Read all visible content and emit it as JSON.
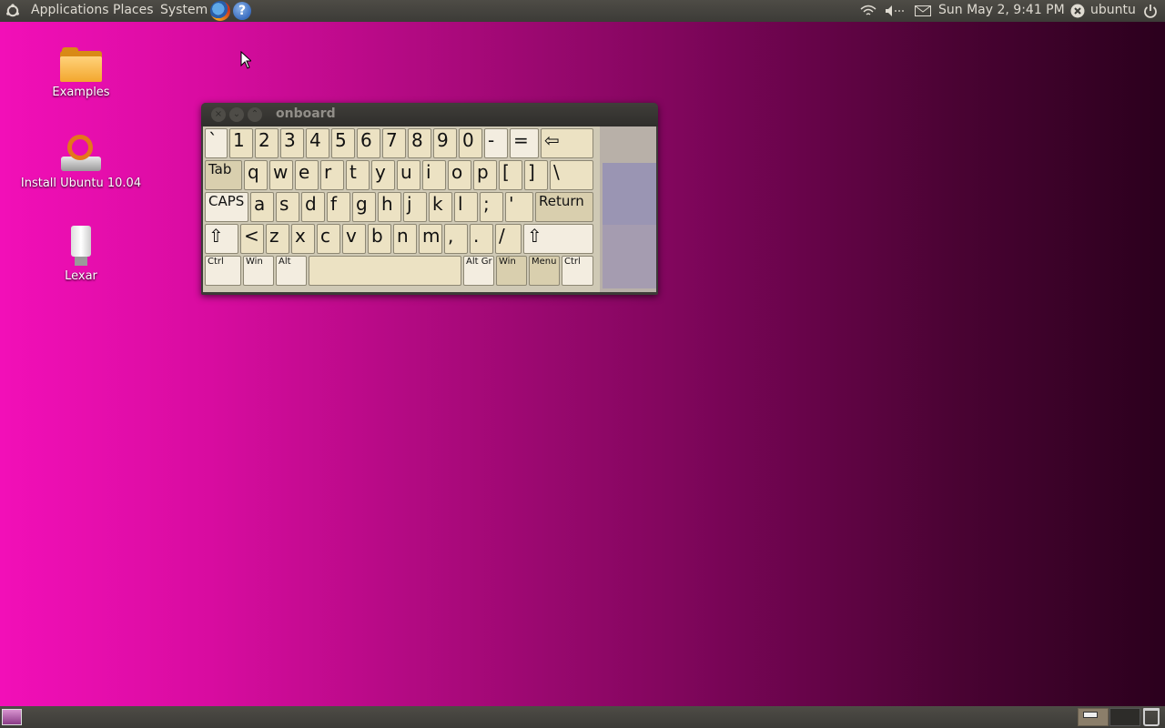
{
  "top_panel": {
    "menus": [
      "Applications",
      "Places",
      "System"
    ],
    "clock": "Sun May  2,  9:41 PM",
    "user": "ubuntu",
    "icons": [
      "ubuntu-logo-icon",
      "firefox-icon",
      "help-icon",
      "network-wireless-icon",
      "volume-icon",
      "mail-icon",
      "user-status-icon",
      "power-icon"
    ]
  },
  "desktop": {
    "icons": [
      {
        "label": "Examples",
        "icon": "folder-icon"
      },
      {
        "label": "Install Ubuntu 10.04",
        "icon": "installer-icon"
      },
      {
        "label": "Lexar",
        "icon": "usb-drive-icon"
      }
    ]
  },
  "onboard": {
    "title": "onboard",
    "rows": [
      [
        "`",
        "1",
        "2",
        "3",
        "4",
        "5",
        "6",
        "7",
        "8",
        "9",
        "0",
        "-",
        "=",
        "⇦"
      ],
      [
        "Tab",
        "q",
        "w",
        "e",
        "r",
        "t",
        "y",
        "u",
        "i",
        "o",
        "p",
        "[",
        "]",
        "\\"
      ],
      [
        "CAPS",
        "a",
        "s",
        "d",
        "f",
        "g",
        "h",
        "j",
        "k",
        "l",
        ";",
        "'",
        "Return"
      ],
      [
        "⇧",
        "<",
        "z",
        "x",
        "c",
        "v",
        "b",
        "n",
        "m",
        ",",
        ".",
        "/",
        "⇧"
      ],
      [
        "Ctrl",
        "Win",
        "Alt",
        "",
        "Alt Gr",
        "Win",
        "Menu",
        "Ctrl"
      ]
    ]
  },
  "bottom_panel": {
    "icons": [
      "show-desktop-icon",
      "workspace-switcher",
      "trash-icon"
    ]
  },
  "colors": {
    "panel": "#3c3b37",
    "key": "#ece2c3",
    "key_light": "#f3ede0",
    "key_dark": "#d9cfae",
    "desktop_left": "#f20fb8",
    "desktop_right": "#2b001d"
  }
}
